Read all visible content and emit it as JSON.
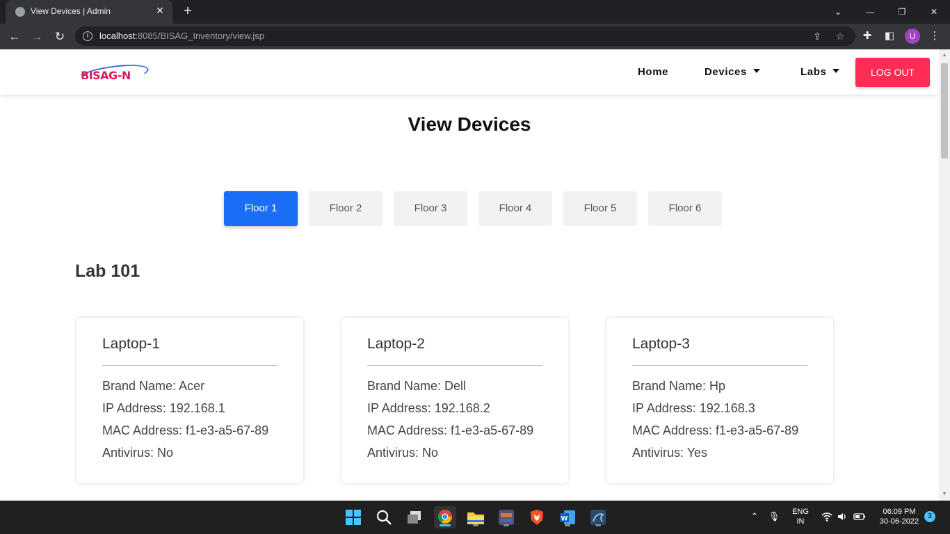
{
  "browser": {
    "tab_title": "View Devices | Admin",
    "url_host": "localhost",
    "url_rest": ":8085/BISAG_Inventory/view.jsp",
    "profile_initial": "U"
  },
  "site": {
    "logo_text": "BISAG-N",
    "nav": {
      "home": "Home",
      "devices": "Devices",
      "labs": "Labs",
      "logout": "LOG OUT"
    }
  },
  "page": {
    "title": "View Devices",
    "floors": [
      {
        "label": "Floor 1",
        "active": true
      },
      {
        "label": "Floor 2",
        "active": false
      },
      {
        "label": "Floor 3",
        "active": false
      },
      {
        "label": "Floor 4",
        "active": false
      },
      {
        "label": "Floor 5",
        "active": false
      },
      {
        "label": "Floor 6",
        "active": false
      }
    ],
    "lab_heading": "Lab 101",
    "devices": [
      {
        "name": "Laptop-1",
        "brand": "Brand Name: Acer",
        "ip": "IP Address: 192.168.1",
        "mac": "MAC Address: f1-e3-a5-67-89",
        "antivirus": "Antivirus: No"
      },
      {
        "name": "Laptop-2",
        "brand": "Brand Name: Dell",
        "ip": "IP Address: 192.168.2",
        "mac": "MAC Address: f1-e3-a5-67-89",
        "antivirus": "Antivirus: No"
      },
      {
        "name": "Laptop-3",
        "brand": "Brand Name: Hp",
        "ip": "IP Address: 192.168.3",
        "mac": "MAC Address: f1-e3-a5-67-89",
        "antivirus": "Antivirus: Yes"
      }
    ]
  },
  "taskbar": {
    "lang_line1": "ENG",
    "lang_line2": "IN",
    "time": "06:09 PM",
    "date": "30-06-2022",
    "notification_count": "3"
  },
  "colors": {
    "accent_blue": "#1a6ef5",
    "logout_red": "#ff2d55",
    "chrome_dark": "#202124"
  }
}
